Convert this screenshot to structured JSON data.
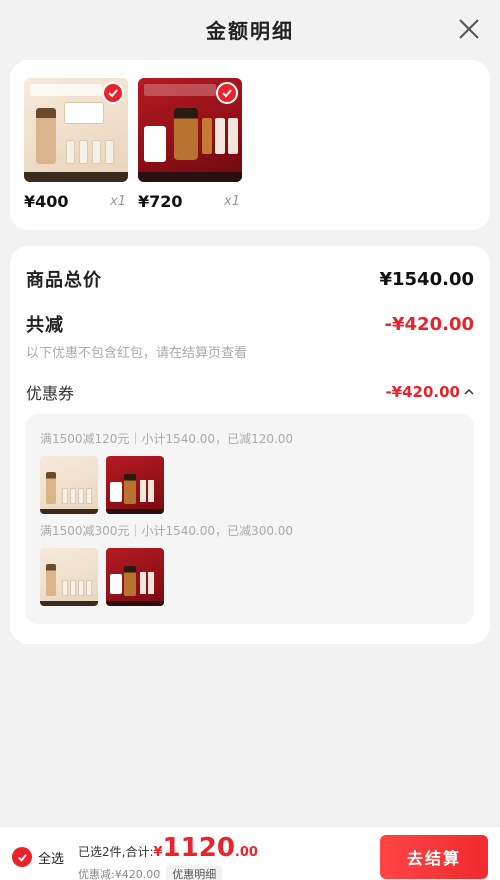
{
  "header": {
    "title": "金额明细",
    "close_icon": "close-icon"
  },
  "products": [
    {
      "price": "¥400",
      "qty": "x1",
      "selected": true
    },
    {
      "price": "¥720",
      "qty": "x1",
      "selected": true
    }
  ],
  "summary": {
    "total_label": "商品总价",
    "total_value": "¥1540.00",
    "discount_label": "共减",
    "discount_value": "-¥420.00",
    "note": "以下优惠不包含红包，请在结算页查看",
    "coupon_label": "优惠券",
    "coupon_value": "-¥420.00",
    "coupon_expand_icon": "chevron-up-icon"
  },
  "coupon_rules": [
    {
      "text": "满1500减120元｜小计1540.00，已减120.00"
    },
    {
      "text": "满1500减300元｜小计1540.00，已减300.00"
    }
  ],
  "footer": {
    "select_all_label": "全选",
    "selected_prefix": "已选2件,合计:",
    "currency": "¥",
    "total_int": "1120",
    "total_dec": ".00",
    "discount_text": "优惠减:¥420.00",
    "detail_label": "优惠明细",
    "checkout_label": "去结算"
  },
  "colors": {
    "accent": "#e8232b",
    "background": "#f2f2f2"
  }
}
